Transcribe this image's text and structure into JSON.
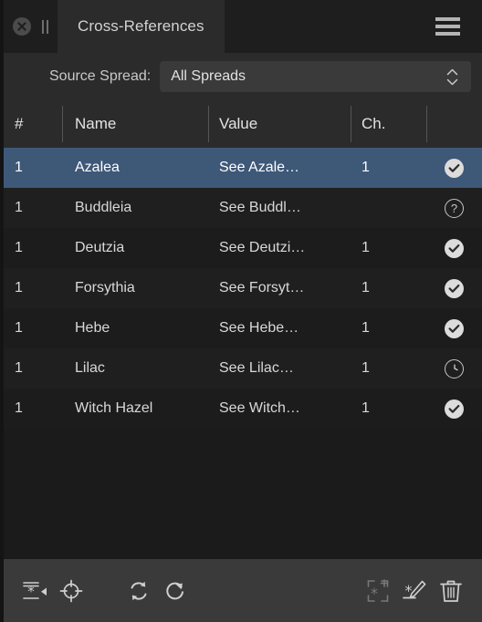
{
  "titlebar": {
    "close_icon": "close-circle-icon",
    "drag_handle_icon": "drag-handle-icon",
    "tab_label": "Cross-References",
    "menu_icon": "hamburger-menu-icon"
  },
  "filter": {
    "label": "Source Spread:",
    "value": "All Spreads",
    "stepper_icon": "stepper-updown-icon",
    "options": [
      "All Spreads"
    ]
  },
  "table": {
    "columns": [
      {
        "key": "num",
        "label": "#"
      },
      {
        "key": "name",
        "label": "Name"
      },
      {
        "key": "value",
        "label": "Value"
      },
      {
        "key": "ch",
        "label": "Ch."
      },
      {
        "key": "status",
        "label": ""
      }
    ],
    "rows": [
      {
        "num": "1",
        "name": "Azalea",
        "value": "See Azale…",
        "ch": "1",
        "status": "check",
        "status_icon": "status-ok-icon",
        "selected": true
      },
      {
        "num": "1",
        "name": "Buddleia",
        "value": "See Buddl…",
        "ch": "",
        "status": "question",
        "status_icon": "status-unknown-icon",
        "selected": false
      },
      {
        "num": "1",
        "name": "Deutzia",
        "value": "See Deutzi…",
        "ch": "1",
        "status": "check",
        "status_icon": "status-ok-icon",
        "selected": false
      },
      {
        "num": "1",
        "name": "Forsythia",
        "value": "See Forsyt…",
        "ch": "1",
        "status": "check",
        "status_icon": "status-ok-icon",
        "selected": false
      },
      {
        "num": "1",
        "name": "Hebe",
        "value": "See Hebe…",
        "ch": "1",
        "status": "check",
        "status_icon": "status-ok-icon",
        "selected": false
      },
      {
        "num": "1",
        "name": "Lilac",
        "value": "See Lilac…",
        "ch": "1",
        "status": "clock",
        "status_icon": "status-pending-icon",
        "selected": false
      },
      {
        "num": "1",
        "name": "Witch Hazel",
        "value": "See Witch…",
        "ch": "1",
        "status": "check",
        "status_icon": "status-ok-icon",
        "selected": false
      }
    ]
  },
  "toolbar": {
    "items": [
      {
        "icon": "go-to-source-icon",
        "enabled": true
      },
      {
        "icon": "go-to-destination-icon",
        "enabled": true
      },
      {
        "icon": "update-cross-reference-icon",
        "enabled": true
      },
      {
        "icon": "relink-cross-reference-icon",
        "enabled": true
      },
      {
        "icon": "new-cross-reference-icon",
        "enabled": false
      },
      {
        "icon": "edit-cross-reference-icon",
        "enabled": true
      },
      {
        "icon": "delete-cross-reference-icon",
        "enabled": true
      }
    ]
  },
  "colors": {
    "selection": "#3e5878",
    "panel_bg": "#1e1e1e",
    "toolbar_bg": "#3a3a3a",
    "header_bg": "#2b2b2b",
    "text": "#d8d8d8"
  }
}
